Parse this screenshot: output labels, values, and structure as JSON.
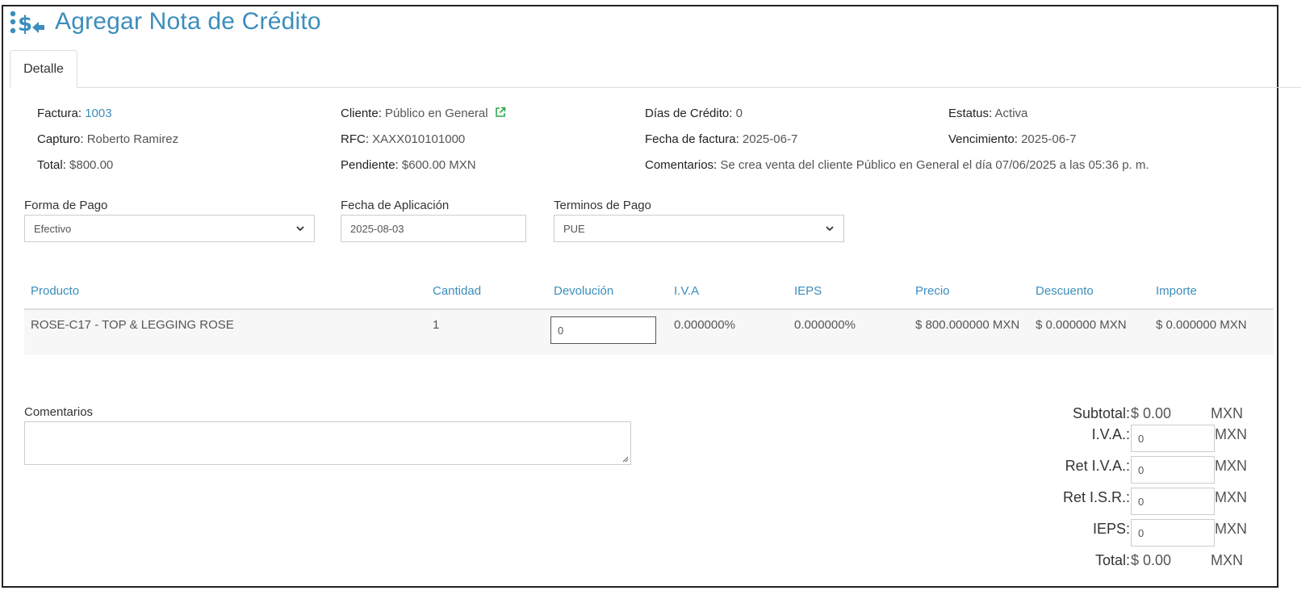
{
  "header": {
    "title": "Agregar Nota de Crédito",
    "icon": "money-transfer-icon",
    "accent_color": "#3c8dbc"
  },
  "tabs": [
    {
      "label": "Detalle",
      "active": true
    }
  ],
  "invoice": {
    "factura_label": "Factura:",
    "factura_value": "1003",
    "cliente_label": "Cliente:",
    "cliente_value": "Público en General",
    "dias_credito_label": "Días de Crédito:",
    "dias_credito_value": "0",
    "estatus_label": "Estatus:",
    "estatus_value": "Activa",
    "capturo_label": "Capturo:",
    "capturo_value": "Roberto Ramirez",
    "rfc_label": "RFC:",
    "rfc_value": "XAXX010101000",
    "fecha_factura_label": "Fecha de factura:",
    "fecha_factura_value": "2025-06-7",
    "vencimiento_label": "Vencimiento:",
    "vencimiento_value": "2025-06-7",
    "total_label": "Total:",
    "total_value": "$800.00",
    "pendiente_label": "Pendiente:",
    "pendiente_value": "$600.00 MXN",
    "comentarios_label": "Comentarios:",
    "comentarios_value": "Se crea venta del cliente Público en General el día 07/06/2025 a las 05:36 p. m."
  },
  "form": {
    "forma_pago_label": "Forma de Pago",
    "forma_pago_value": "Efectivo",
    "fecha_aplicacion_label": "Fecha de Aplicación",
    "fecha_aplicacion_value": "2025-08-03",
    "terminos_pago_label": "Terminos de Pago",
    "terminos_pago_value": "PUE"
  },
  "table": {
    "headers": [
      "Producto",
      "Cantidad",
      "Devolución",
      "I.V.A",
      "IEPS",
      "Precio",
      "Descuento",
      "Importe"
    ],
    "rows": [
      {
        "producto": "ROSE-C17 - TOP & LEGGING ROSE",
        "cantidad": "1",
        "devolucion": "0",
        "iva": "0.000000%",
        "ieps": "0.000000%",
        "precio": "$ 800.000000 MXN",
        "descuento": "$ 0.000000 MXN",
        "importe": "$ 0.000000 MXN"
      }
    ]
  },
  "comments": {
    "label": "Comentarios",
    "value": ""
  },
  "totals": {
    "subtotal_label": "Subtotal:",
    "subtotal_value": "$ 0.00",
    "subtotal_currency": "MXN",
    "iva_label": "I.V.A.:",
    "iva_value": "0",
    "iva_currency": "MXN",
    "ret_iva_label": "Ret I.V.A.:",
    "ret_iva_value": "0",
    "ret_iva_currency": "MXN",
    "ret_isr_label": "Ret I.S.R.:",
    "ret_isr_value": "0",
    "ret_isr_currency": "MXN",
    "ieps_label": "IEPS:",
    "ieps_value": "0",
    "ieps_currency": "MXN",
    "total_label": "Total:",
    "total_value": "$ 0.00",
    "total_currency": "MXN"
  }
}
